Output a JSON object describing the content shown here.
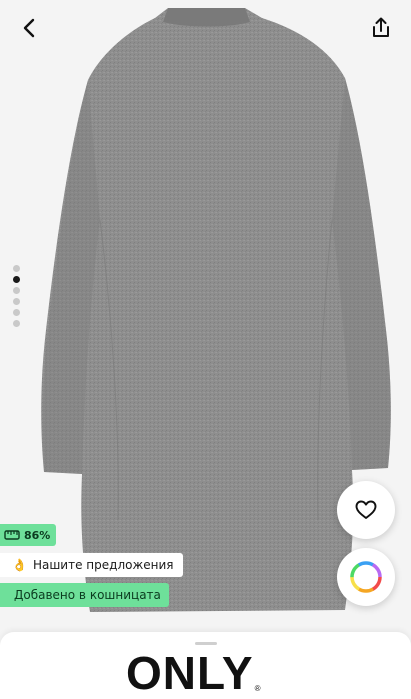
{
  "product": {
    "image_alt": "Grey wool coat, back view",
    "gallery_count": 6,
    "gallery_active_index": 1
  },
  "header": {
    "back_icon": "chevron-left-icon",
    "share_icon": "share-icon"
  },
  "badges": {
    "percent_value": "86%",
    "offer_emoji": "👌",
    "offer_label": "Нашите предложения",
    "cart_label": "Добавено в кошницата"
  },
  "actions": {
    "favorite_icon": "heart-icon",
    "color_icon": "color-wheel-icon"
  },
  "brand": {
    "name": "ONLY",
    "registered": "®"
  },
  "colors": {
    "accent_green": "#6ee09a",
    "coat_grey": "#8f8f8f",
    "background": "#f4f4f4"
  }
}
